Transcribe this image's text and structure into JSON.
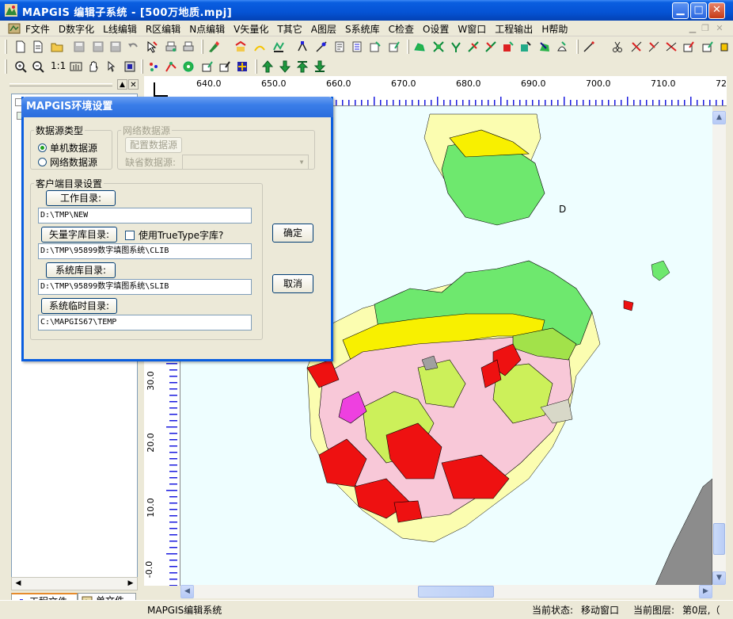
{
  "window": {
    "title": "MAPGIS 编辑子系统 - [500万地质.mpj]"
  },
  "menu": [
    "F文件",
    "D数字化",
    "L线编辑",
    "R区编辑",
    "N点编辑",
    "V矢量化",
    "T其它",
    "A图层",
    "S系统库",
    "C检查",
    "O设置",
    "W窗口",
    "工程输出",
    "H帮助"
  ],
  "ruler": {
    "top_labels": [
      "640.0",
      "650.0",
      "660.0",
      "670.0",
      "680.0",
      "690.0",
      "700.0",
      "710.0",
      "72"
    ],
    "left_labels": [
      "30.0",
      "20.0",
      "10.0",
      "-0.0"
    ]
  },
  "map": {
    "label_d": "D"
  },
  "left_panel": {
    "tabs": [
      "工程文件",
      "单文件"
    ]
  },
  "status": {
    "app": "MAPGIS编辑系统",
    "state_label": "当前状态:",
    "state_value": "移动窗口",
    "layer_label": "当前图层:",
    "layer_value": "第0层,（"
  },
  "dialog": {
    "title": "MAPGIS环境设置",
    "datasource": {
      "legend": "数据源类型",
      "options": [
        "单机数据源",
        "网络数据源"
      ],
      "selected": "单机数据源"
    },
    "network": {
      "legend": "网络数据源",
      "config_button": "配置数据源",
      "default_label": "缺省数据源:",
      "default_value": ""
    },
    "client": {
      "legend": "客户端目录设置",
      "work_dir_button": "工作目录:",
      "work_dir": "D:\\TMP\\NEW",
      "vector_font_button": "矢量字库目录:",
      "truetype_label": "使用TrueType字库?",
      "vector_font_dir": "D:\\TMP\\95899数字填图系统\\CLIB",
      "syslib_button": "系统库目录:",
      "syslib_dir": "D:\\TMP\\95899数字填图系统\\SLIB",
      "temp_button": "系统临时目录:",
      "temp_dir": "C:\\MAPGIS67\\TEMP"
    },
    "ok": "确定",
    "cancel": "取消"
  },
  "colors": {
    "title_blue": "#0a5ee0",
    "map_bg": "#eefeff",
    "pink": "#f8c8d8",
    "red": "#ee1111",
    "green": "#6ee86e",
    "yellow": "#f8f000"
  }
}
